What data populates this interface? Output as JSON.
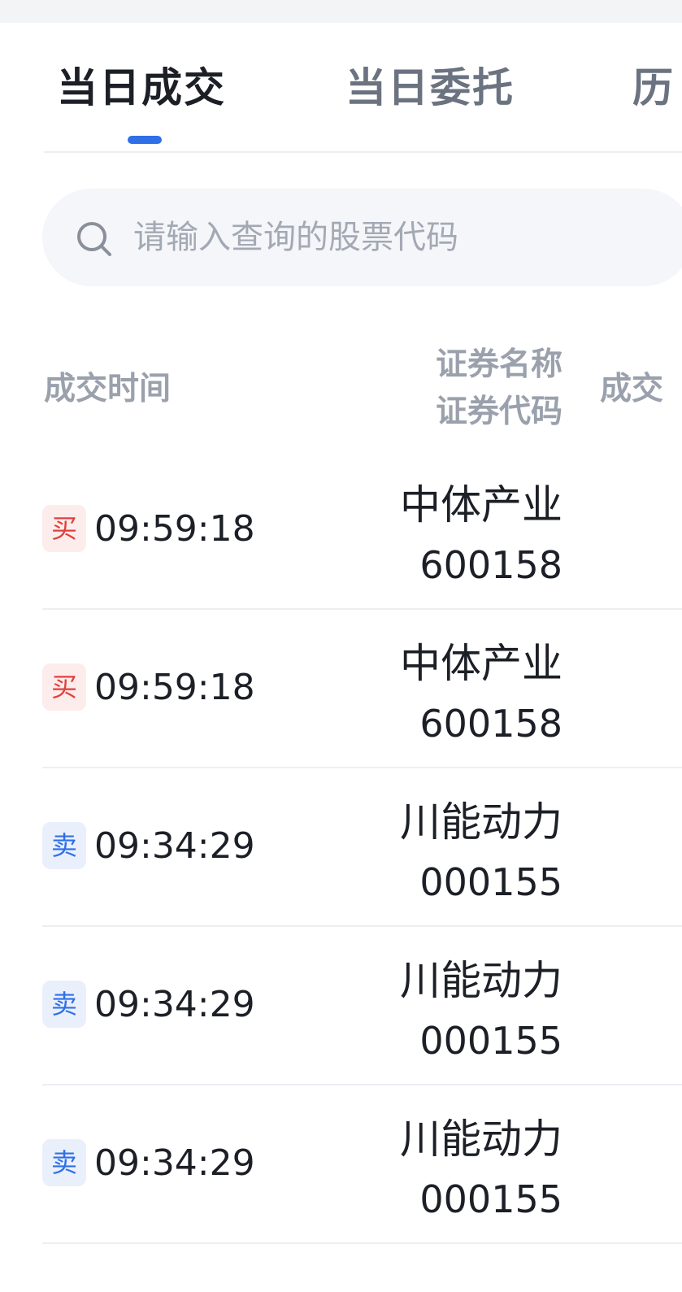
{
  "tabs": [
    {
      "label": "当日成交",
      "active": true
    },
    {
      "label": "当日委托",
      "active": false
    },
    {
      "label": "历",
      "active": false
    }
  ],
  "search": {
    "icon": "search-icon",
    "placeholder": "请输入查询的股票代码"
  },
  "table": {
    "columns": {
      "time": "成交时间",
      "name": "证券名称",
      "code": "证券代码",
      "deal": "成交"
    },
    "rows": [
      {
        "side": "买",
        "side_type": "buy",
        "time": "09:59:18",
        "name": "中体产业",
        "code": "600158"
      },
      {
        "side": "买",
        "side_type": "buy",
        "time": "09:59:18",
        "name": "中体产业",
        "code": "600158"
      },
      {
        "side": "卖",
        "side_type": "sell",
        "time": "09:34:29",
        "name": "川能动力",
        "code": "000155"
      },
      {
        "side": "卖",
        "side_type": "sell",
        "time": "09:34:29",
        "name": "川能动力",
        "code": "000155"
      },
      {
        "side": "卖",
        "side_type": "sell",
        "time": "09:34:29",
        "name": "川能动力",
        "code": "000155"
      }
    ]
  },
  "colors": {
    "accent": "#2f6fe8",
    "buy": "#e0413d",
    "sell": "#2f6fe8"
  }
}
